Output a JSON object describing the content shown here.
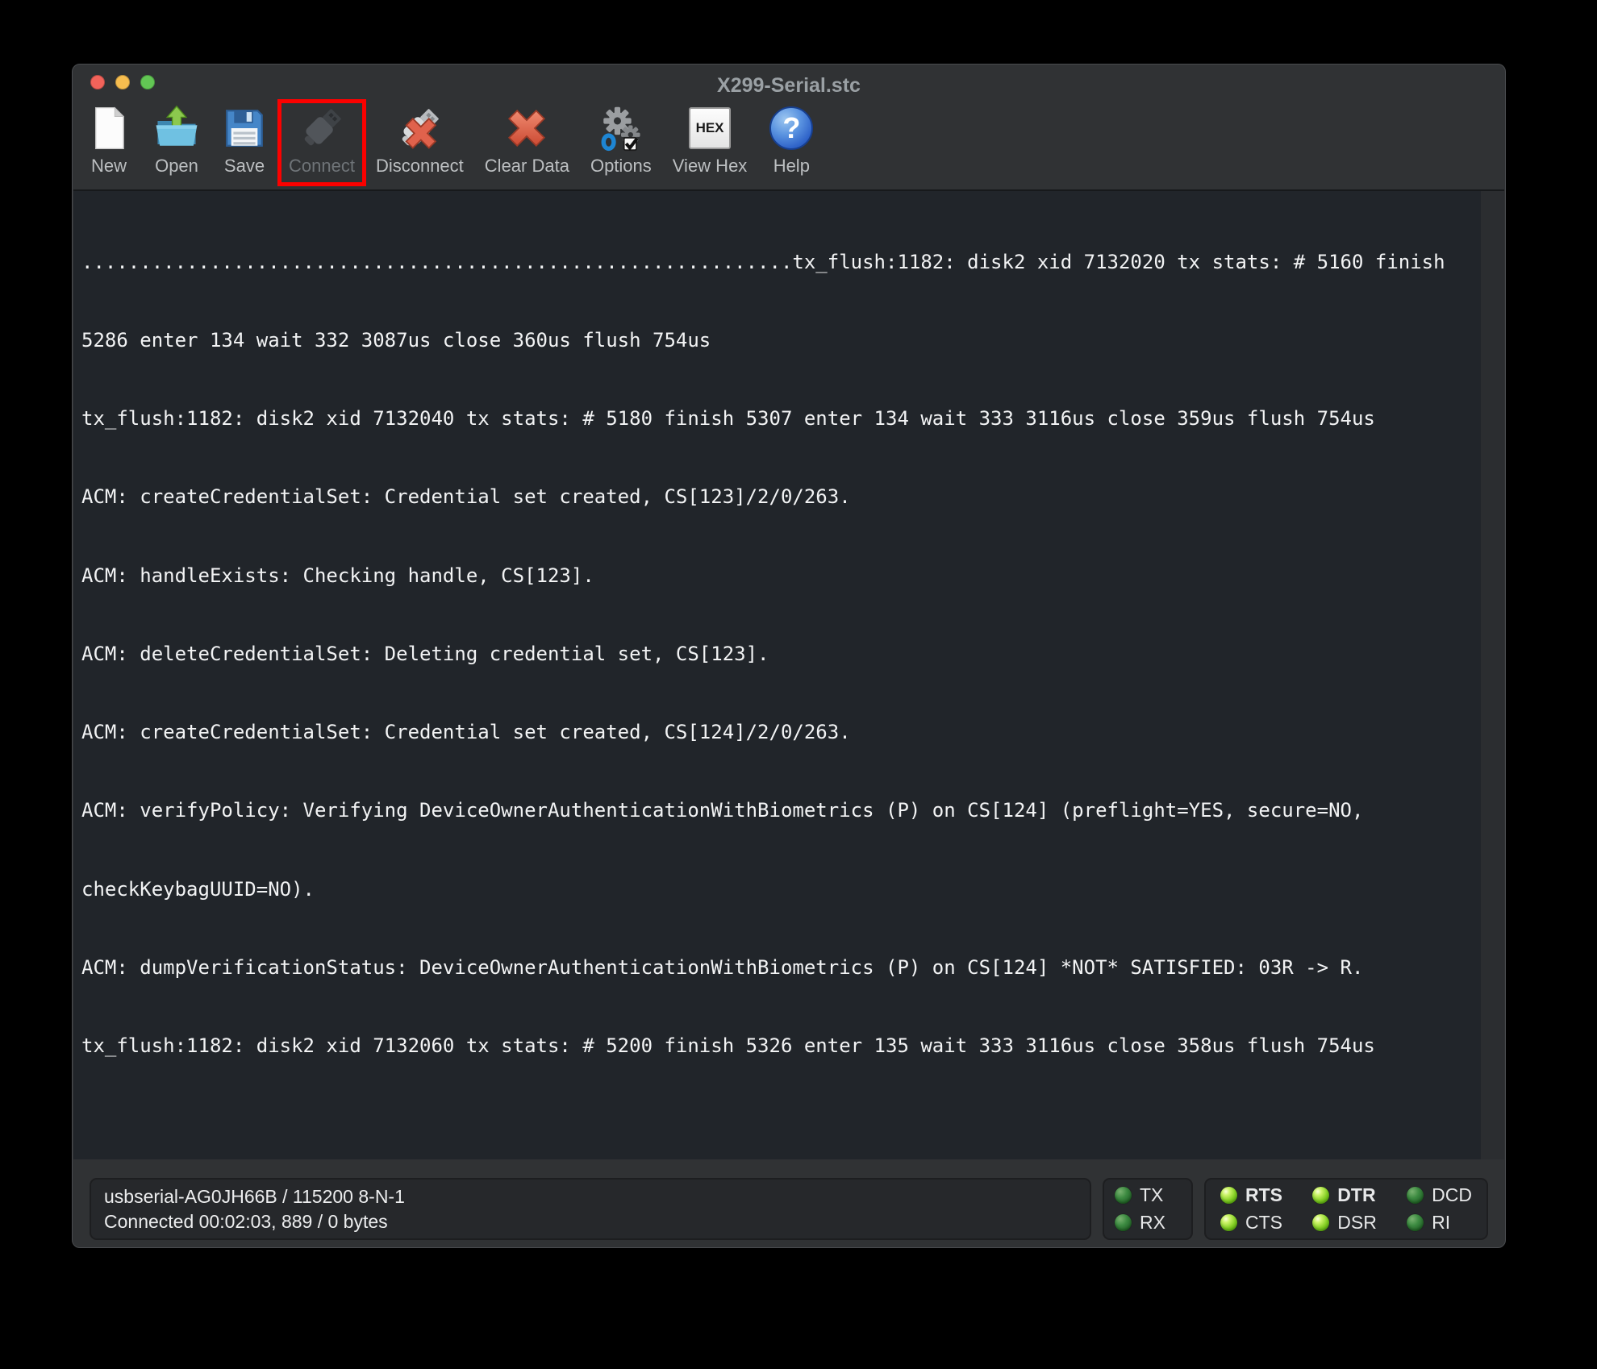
{
  "window": {
    "title": "X299-Serial.stc",
    "traffic_lights": [
      "close",
      "minimize",
      "zoom"
    ]
  },
  "toolbar": {
    "items": [
      {
        "label": "New",
        "icon": "new-document-icon"
      },
      {
        "label": "Open",
        "icon": "open-folder-icon"
      },
      {
        "label": "Save",
        "icon": "save-floppy-icon"
      },
      {
        "label": "Connect",
        "icon": "usb-plug-icon",
        "disabled": true,
        "annotated": true
      },
      {
        "label": "Disconnect",
        "icon": "usb-plug-x-icon"
      },
      {
        "label": "Clear Data",
        "icon": "red-x-icon"
      },
      {
        "label": "Options",
        "icon": "gears-icon"
      },
      {
        "label": "View Hex",
        "icon": "hex-box-icon"
      },
      {
        "label": "Help",
        "icon": "question-mark-icon"
      }
    ],
    "hex_icon_text": "HEX",
    "help_icon_glyph": "?"
  },
  "terminal": {
    "lines": [
      ".............................................................tx_flush:1182: disk2 xid 7132020 tx stats: # 5160 finish",
      "5286 enter 134 wait 332 3087us close 360us flush 754us",
      "tx_flush:1182: disk2 xid 7132040 tx stats: # 5180 finish 5307 enter 134 wait 333 3116us close 359us flush 754us",
      "ACM: createCredentialSet: Credential set created, CS[123]/2/0/263.",
      "ACM: handleExists: Checking handle, CS[123].",
      "ACM: deleteCredentialSet: Deleting credential set, CS[123].",
      "ACM: createCredentialSet: Credential set created, CS[124]/2/0/263.",
      "ACM: verifyPolicy: Verifying DeviceOwnerAuthenticationWithBiometrics (P) on CS[124] (preflight=YES, secure=NO,",
      "checkKeybagUUID=NO).",
      "ACM: dumpVerificationStatus: DeviceOwnerAuthenticationWithBiometrics (P) on CS[124] *NOT* SATISFIED: 03R -> R.",
      "tx_flush:1182: disk2 xid 7132060 tx stats: # 5200 finish 5326 enter 135 wait 333 3116us close 358us flush 754us"
    ]
  },
  "status_bar": {
    "port_info": "usbserial-AG0JH66B / 115200 8-N-1",
    "connection_info": "Connected 00:02:03, 889 / 0 bytes",
    "serial_leds": [
      {
        "label": "TX",
        "on": false
      },
      {
        "label": "RX",
        "on": false
      }
    ],
    "modem_leds": [
      {
        "label": "RTS",
        "on": true,
        "bold": true
      },
      {
        "label": "CTS",
        "on": true,
        "bold": false
      },
      {
        "label": "DTR",
        "on": true,
        "bold": true
      },
      {
        "label": "DSR",
        "on": true,
        "bold": false
      },
      {
        "label": "DCD",
        "on": false,
        "bold": false
      },
      {
        "label": "RI",
        "on": false,
        "bold": false
      }
    ]
  },
  "annotation": {
    "shape": "rectangle",
    "color": "#fb0100",
    "target": "Connect toolbar button"
  },
  "colors": {
    "window_chrome": "#303234",
    "terminal_background": "#21252a",
    "terminal_text": "#f2f3f4",
    "led_on": "#86d026",
    "led_off": "#2e6b33",
    "annotation_red": "#fb0100",
    "traffic_red": "#f2635a",
    "traffic_yellow": "#f6bd4f",
    "traffic_green": "#62c654"
  }
}
